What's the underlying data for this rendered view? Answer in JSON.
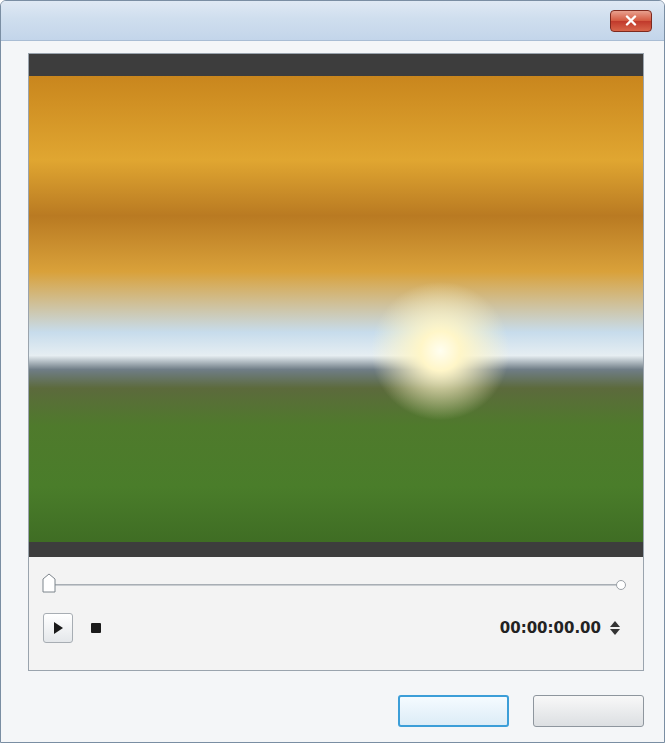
{
  "window": {
    "title": ""
  },
  "timeline": {
    "level": 0
  },
  "time": "00:00:00.00",
  "buttons": [
    {
      "label": "",
      "focused": true
    },
    {
      "label": "",
      "focused": false
    }
  ]
}
